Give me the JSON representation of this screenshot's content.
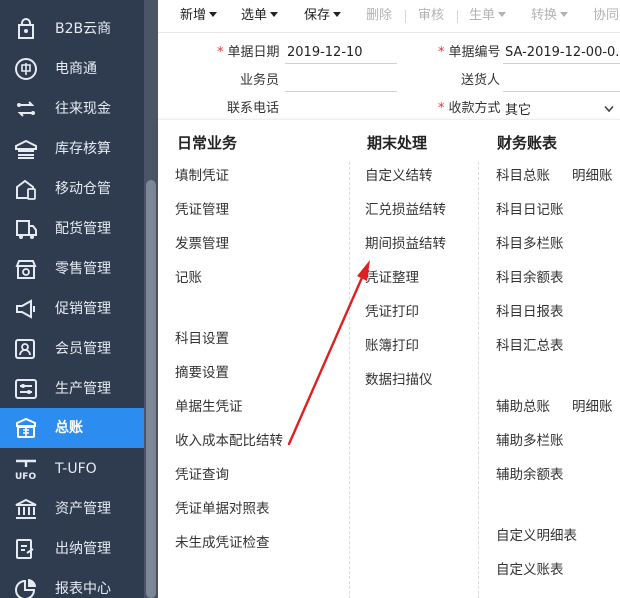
{
  "sidebar": {
    "items": [
      {
        "label": "B2B云商",
        "icon": "shopping-bag-icon"
      },
      {
        "label": "电商通",
        "icon": "ecommerce-icon"
      },
      {
        "label": "往来现金",
        "icon": "exchange-icon"
      },
      {
        "label": "库存核算",
        "icon": "inventory-icon"
      },
      {
        "label": "移动仓管",
        "icon": "mobile-warehouse-icon"
      },
      {
        "label": "配货管理",
        "icon": "delivery-truck-icon"
      },
      {
        "label": "零售管理",
        "icon": "retail-shop-icon"
      },
      {
        "label": "促销管理",
        "icon": "megaphone-icon"
      },
      {
        "label": "会员管理",
        "icon": "member-card-icon"
      },
      {
        "label": "生产管理",
        "icon": "production-icon"
      },
      {
        "label": "总账",
        "icon": "ledger-icon",
        "active": true
      },
      {
        "label": "T-UFO",
        "icon": "ufo-icon"
      },
      {
        "label": "资产管理",
        "icon": "bank-building-icon"
      },
      {
        "label": "出纳管理",
        "icon": "cashier-icon"
      },
      {
        "label": "报表中心",
        "icon": "pie-chart-icon"
      }
    ]
  },
  "toolbar": {
    "new": "新增",
    "select": "选单",
    "save": "保存",
    "delete": "删除",
    "review": "审核",
    "generate": "生单",
    "convert": "转换",
    "collab": "协同"
  },
  "form": {
    "date_label": "单据日期",
    "date_value": "2019-12-10",
    "number_label": "单据编号",
    "number_value": "SA-2019-12-00-0...",
    "salesman_label": "业务员",
    "deliverer_label": "送货人",
    "phone_label": "联系电话",
    "payment_label": "收款方式",
    "payment_value": "其它"
  },
  "menu": {
    "columns": [
      {
        "title": "日常业务",
        "groups": [
          [
            "填制凭证",
            "凭证管理",
            "发票管理",
            "记账"
          ],
          [
            "科目设置",
            "摘要设置",
            "单据生凭证",
            "收入成本配比结转",
            "凭证查询",
            "凭证单据对照表",
            "未生成凭证检查"
          ]
        ]
      },
      {
        "title": "期末处理",
        "groups": [
          [
            "自定义结转",
            "汇兑损益结转",
            "期间损益结转",
            "凭证整理",
            "凭证打印",
            "账簿打印",
            "数据扫描仪"
          ]
        ]
      },
      {
        "title": "财务账表",
        "groups": [
          [
            "科目总账",
            "科目日记账",
            "科目多栏账",
            "科目余额表",
            "科目日报表",
            "科目汇总表"
          ],
          [
            "辅助总账",
            "辅助多栏账",
            "辅助余额表"
          ],
          [
            "自定义明细表",
            "自定义账表"
          ]
        ],
        "extras": [
          "明细账",
          "明细账"
        ]
      }
    ]
  },
  "colors": {
    "sidebar_bg": "#2f3b4f",
    "active_bg": "#2d8cf0",
    "required": "#e33333",
    "annotation_arrow": "#e02020"
  }
}
